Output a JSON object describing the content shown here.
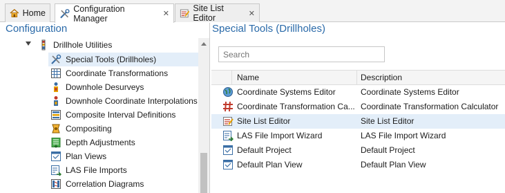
{
  "tabs": [
    {
      "label": "Home",
      "icon": "home-icon",
      "closable": false,
      "active": false
    },
    {
      "label": "Configuration Manager",
      "icon": "tools-icon",
      "closable": true,
      "active": true
    },
    {
      "label": "Site List Editor",
      "icon": "list-editor-icon",
      "closable": true,
      "active": false
    }
  ],
  "left_heading": "Configuration",
  "right_heading": "Special Tools (Drillholes)",
  "tree": {
    "parent": {
      "label": "Drillhole Utilities",
      "icon": "drillhole-icon",
      "expanded": true
    },
    "items": [
      {
        "label": "Special Tools (Drillholes)",
        "icon": "tools-icon",
        "selected": true
      },
      {
        "label": "Coordinate Transformations",
        "icon": "grid-icon"
      },
      {
        "label": "Downhole Desurveys",
        "icon": "desurvey-icon"
      },
      {
        "label": "Downhole Coordinate Interpolations",
        "icon": "interpolation-icon"
      },
      {
        "label": "Composite Interval Definitions",
        "icon": "interval-icon"
      },
      {
        "label": "Compositing",
        "icon": "compositing-icon"
      },
      {
        "label": "Depth Adjustments",
        "icon": "depth-icon"
      },
      {
        "label": "Plan Views",
        "icon": "plan-view-icon"
      },
      {
        "label": "LAS File Imports",
        "icon": "las-import-icon"
      },
      {
        "label": "Correlation Diagrams",
        "icon": "correlation-icon"
      }
    ]
  },
  "search": {
    "placeholder": "Search",
    "value": ""
  },
  "grid": {
    "columns": [
      "Name",
      "Description"
    ],
    "rows": [
      {
        "name": "Coordinate Systems Editor",
        "description": "Coordinate Systems Editor",
        "icon": "globe-icon",
        "selected": false
      },
      {
        "name": "Coordinate Transformation Ca...",
        "description": "Coordinate Transformation Calculator",
        "icon": "hash-icon",
        "selected": false
      },
      {
        "name": "Site List Editor",
        "description": "Site List Editor",
        "icon": "list-editor-icon",
        "selected": true
      },
      {
        "name": "LAS File Import Wizard",
        "description": "LAS File Import Wizard",
        "icon": "las-import-icon",
        "selected": false
      },
      {
        "name": "Default Project",
        "description": "Default Project",
        "icon": "plan-view-icon",
        "selected": false
      },
      {
        "name": "Default Plan View",
        "description": "Default Plan View",
        "icon": "plan-view-icon",
        "selected": false
      }
    ]
  },
  "colors": {
    "heading": "#2a6aa9",
    "selection": "#e3eef9",
    "tab_strip": "#f3f3f3"
  }
}
